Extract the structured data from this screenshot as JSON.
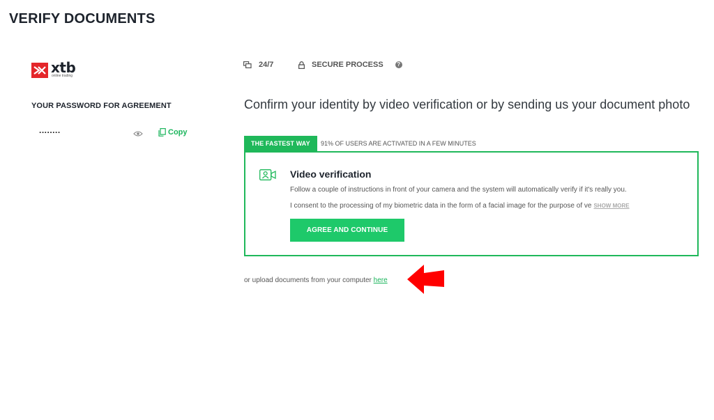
{
  "page": {
    "title": "VERIFY DOCUMENTS"
  },
  "brand": {
    "name": "xtb",
    "tagline": "online trading",
    "color": "#e4262a"
  },
  "password": {
    "label": "YOUR PASSWORD FOR AGREEMENT",
    "value": "........",
    "copy_label": "Copy"
  },
  "info_bar": {
    "support": "24/7",
    "secure": "SECURE PROCESS",
    "help": "?"
  },
  "headline": "Confirm your identity by video verification or by sending us your document photo",
  "tabs": {
    "fastest": "THE FASTEST WAY",
    "stat": "91% OF USERS ARE ACTIVATED IN A FEW MINUTES"
  },
  "card": {
    "title": "Video verification",
    "description": "Follow a couple of instructions in front of your camera and the system will automatically verify if it's really you.",
    "consent": "I consent to the processing of my biometric data in the form of a facial image for the purpose of ve",
    "show_more": "SHOW MORE",
    "button": "AGREE AND CONTINUE"
  },
  "upload": {
    "text": "or upload documents from your computer ",
    "link": "here"
  },
  "colors": {
    "accent": "#1fb85a",
    "button": "#1ec96a",
    "arrow": "#ff0000"
  }
}
